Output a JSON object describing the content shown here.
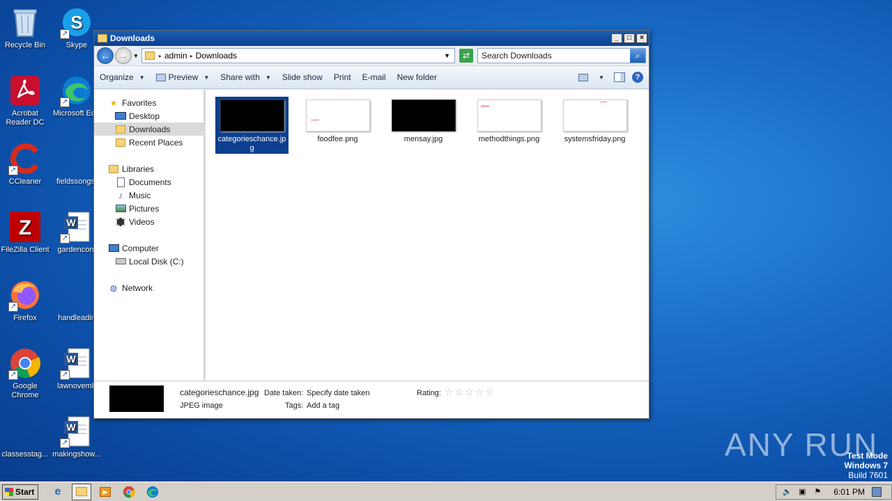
{
  "desktop": {
    "icons": [
      {
        "label": "Recycle Bin",
        "icon": "recycle-bin-icon"
      },
      {
        "label": "Skype",
        "icon": "skype-icon"
      },
      {
        "label": "Acrobat Reader DC",
        "icon": "acrobat-icon"
      },
      {
        "label": "Microsoft Ed",
        "icon": "edge-icon"
      },
      {
        "label": "CCleaner",
        "icon": "ccleaner-icon"
      },
      {
        "label": "fieldssongs.",
        "icon": "blank-file-icon"
      },
      {
        "label": "FileZilla Client",
        "icon": "filezilla-icon"
      },
      {
        "label": "gardencont",
        "icon": "word-doc-icon"
      },
      {
        "label": "Firefox",
        "icon": "firefox-icon"
      },
      {
        "label": "handleadin",
        "icon": "blank-file-icon"
      },
      {
        "label": "Google Chrome",
        "icon": "chrome-icon"
      },
      {
        "label": "lawnovemb",
        "icon": "word-doc-icon"
      },
      {
        "label": "classesstag...",
        "icon": "blank-file-icon"
      },
      {
        "label": "makingshow...",
        "icon": "word-doc-icon"
      }
    ]
  },
  "window": {
    "title": "Downloads",
    "buttons": {
      "minimize": "_",
      "maximize": "□",
      "close": "×"
    },
    "address": {
      "crumbs": [
        "admin",
        "Downloads"
      ]
    },
    "search": {
      "placeholder": "Search Downloads"
    },
    "toolbar": {
      "organize": "Organize",
      "preview": "Preview",
      "share_with": "Share with",
      "slide_show": "Slide show",
      "print": "Print",
      "email": "E-mail",
      "new_folder": "New folder"
    },
    "nav": {
      "favorites": "Favorites",
      "desktop": "Desktop",
      "downloads": "Downloads",
      "recent_places": "Recent Places",
      "libraries": "Libraries",
      "documents": "Documents",
      "music": "Music",
      "pictures": "Pictures",
      "videos": "Videos",
      "computer": "Computer",
      "local_disk": "Local Disk (C:)",
      "network": "Network"
    },
    "files": [
      {
        "name": "categorieschance.jpg",
        "thumb": "dark",
        "selected": true
      },
      {
        "name": "foodfee.png",
        "thumb": "light",
        "selected": false
      },
      {
        "name": "mensay.jpg",
        "thumb": "dark",
        "selected": false
      },
      {
        "name": "methodthings.png",
        "thumb": "light",
        "selected": false
      },
      {
        "name": "systemsfriday.png",
        "thumb": "light",
        "selected": false
      }
    ],
    "details": {
      "filename": "categorieschance.jpg",
      "filetype": "JPEG image",
      "date_taken_label": "Date taken:",
      "date_taken_value": "Specify date taken",
      "tags_label": "Tags:",
      "tags_value": "Add a tag",
      "rating_label": "Rating:",
      "rating": 0
    }
  },
  "watermark": "ANY RUN",
  "test_mode": {
    "line1": "Test Mode",
    "line2": "Windows 7",
    "line3": "Build 7601"
  },
  "taskbar": {
    "start": "Start",
    "clock": "6:01 PM"
  }
}
